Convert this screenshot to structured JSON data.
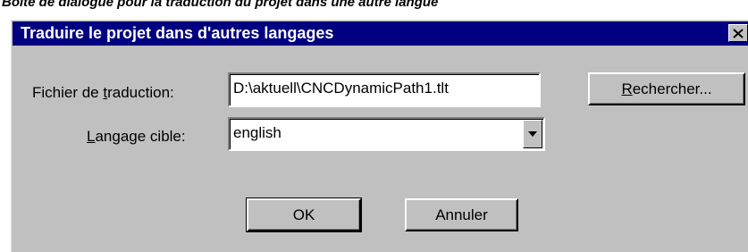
{
  "caption": "Boîte de dialogue pour la traduction du projet dans une autre langue",
  "dialog": {
    "title": "Traduire le projet dans d'autres langages",
    "close_icon": "close-icon"
  },
  "form": {
    "file_label_pre": "Fichier de ",
    "file_label_accel": "t",
    "file_label_post": "raduction:",
    "file_value": "D:\\aktuell\\CNCDynamicPath1.tlt",
    "browse_accel": "R",
    "browse_rest": "echercher...",
    "lang_label_accel": "L",
    "lang_label_post": "angage cible:",
    "lang_value": "english",
    "dropdown_icon": "chevron-down-icon"
  },
  "buttons": {
    "ok": "OK",
    "cancel": "Annuler"
  }
}
